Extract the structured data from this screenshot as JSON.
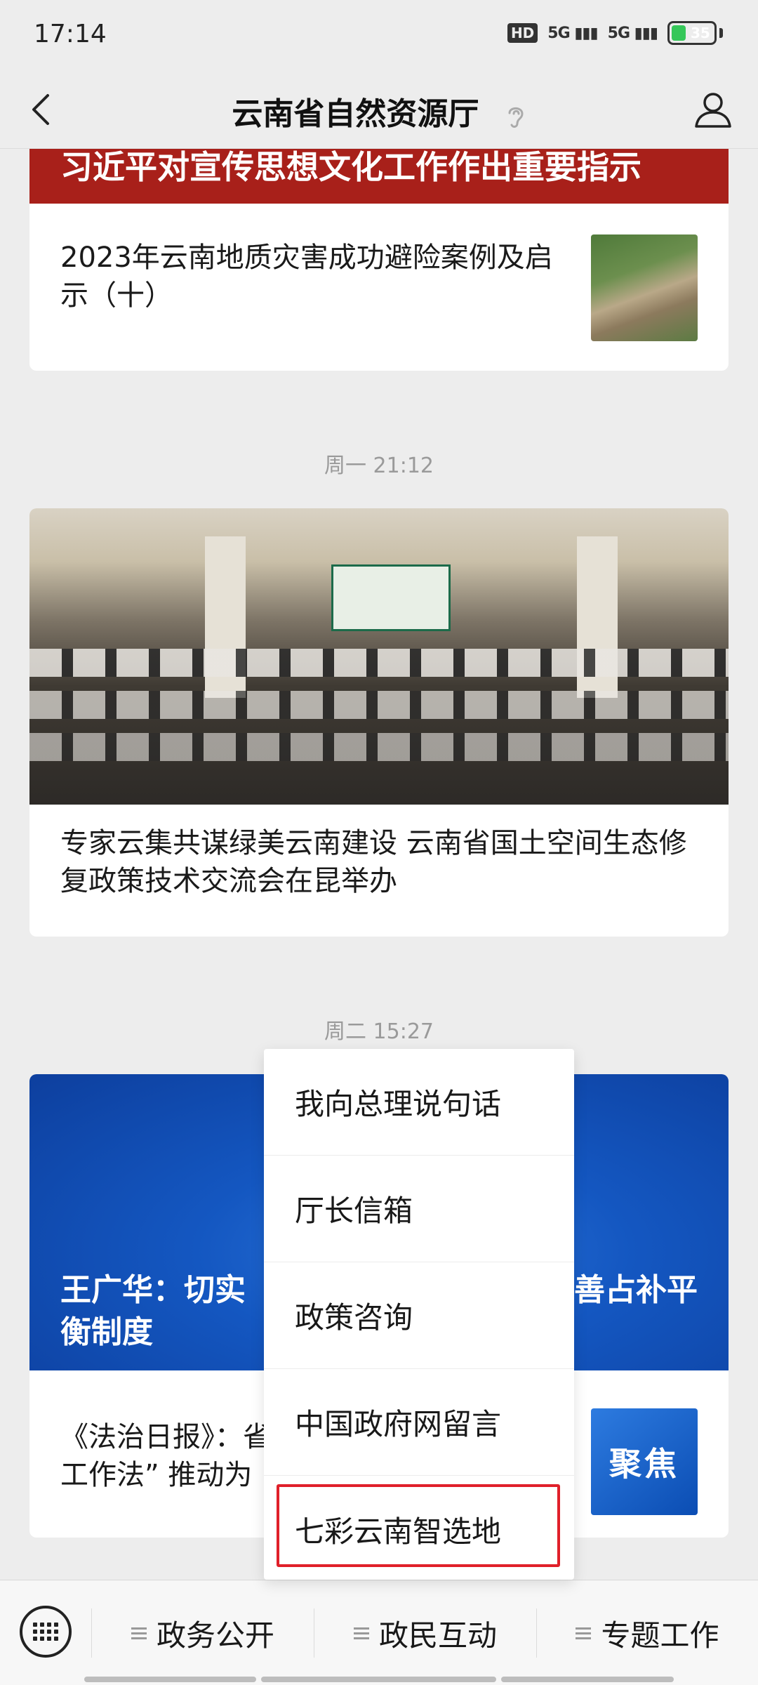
{
  "status_bar": {
    "time": "17:14",
    "signal_1": "5G",
    "signal_2": "5G",
    "hd": "HD",
    "battery": "35",
    "battery_level": 0.35
  },
  "header": {
    "title": "云南省自然资源厅"
  },
  "feed": {
    "banner_text": "习近平对宣传思想文化工作作出重要指示",
    "article1": {
      "title": "2023年云南地质灾害成功避险案例及启示（十）"
    },
    "timestamp1": "周一 21:12",
    "article2": {
      "title": "专家云集共谋绿美云南建设 云南省国土空间生态修复政策技术交流会在昆举办"
    },
    "timestamp2": "周二 15:27",
    "article3": {
      "banner_left": "王广华：切实",
      "banner_left_line2": "衡制度",
      "banner_right": "善占补平",
      "summary_line1": "《法治日报》：省",
      "summary_line2": "工作法” 推动为",
      "thumb_label": "聚焦"
    }
  },
  "popup_menu": {
    "items": [
      "我向总理说句话",
      "厅长信箱",
      "政策咨询",
      "中国政府网留言",
      "七彩云南智选地"
    ],
    "highlight_color": "#e0202a"
  },
  "bottom_menu": {
    "items": [
      "政务公开",
      "政民互动",
      "专题工作"
    ]
  }
}
